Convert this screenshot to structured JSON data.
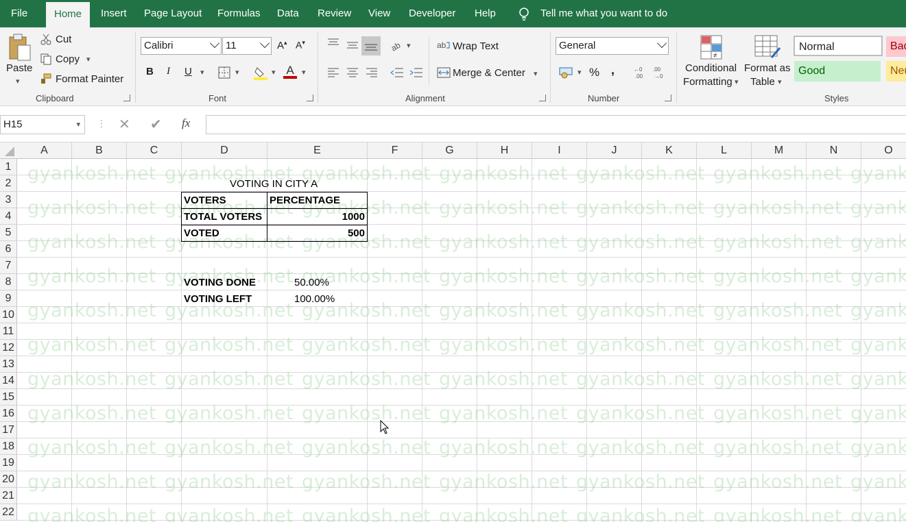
{
  "menu": {
    "file": "File",
    "home": "Home",
    "insert": "Insert",
    "page_layout": "Page Layout",
    "formulas": "Formulas",
    "data": "Data",
    "review": "Review",
    "view": "View",
    "developer": "Developer",
    "help": "Help",
    "tell_me": "Tell me what you want to do"
  },
  "clipboard": {
    "paste": "Paste",
    "cut": "Cut",
    "copy": "Copy",
    "format_painter": "Format Painter",
    "label": "Clipboard"
  },
  "font": {
    "name": "Calibri",
    "size": "11",
    "label": "Font",
    "bold": "B",
    "italic": "I",
    "underline": "U"
  },
  "alignment": {
    "wrap_text": "Wrap Text",
    "merge_center": "Merge & Center",
    "label": "Alignment"
  },
  "number": {
    "format": "General",
    "label": "Number",
    "percent": "%",
    "comma": ","
  },
  "styles": {
    "conditional_line1": "Conditional",
    "conditional_line2": "Formatting",
    "format_as_line1": "Format as",
    "format_as_line2": "Table",
    "normal": "Normal",
    "bad": "Bad",
    "good": "Good",
    "neutral": "Neu",
    "label": "Styles"
  },
  "formula_bar": {
    "name_box": "H15",
    "fx": "fx",
    "content": ""
  },
  "columns": [
    "A",
    "B",
    "C",
    "D",
    "E",
    "F",
    "G",
    "H",
    "I",
    "J",
    "K",
    "L",
    "M",
    "N",
    "O"
  ],
  "rows": [
    "1",
    "2",
    "3",
    "4",
    "5",
    "6",
    "7",
    "8",
    "9",
    "10",
    "11",
    "12",
    "13",
    "14",
    "15",
    "16",
    "17",
    "18",
    "19",
    "20",
    "21",
    "22"
  ],
  "watermark": "gyankosh.net",
  "sheet": {
    "title": "VOTING IN CITY A",
    "header_voters": "VOTERS",
    "header_percentage": "PERCENTAGE",
    "total_voters_label": "TOTAL VOTERS",
    "total_voters_value": "1000",
    "voted_label": "VOTED",
    "voted_value": "500",
    "voting_done_label": "VOTING DONE",
    "voting_done_value": "50.00%",
    "voting_left_label": "VOTING LEFT",
    "voting_left_value": "100.00%"
  },
  "colors": {
    "brand": "#217346",
    "ribbon": "#f3f3f3",
    "good_fill": "#c6efce",
    "bad_fill": "#ffc7ce",
    "neutral_fill": "#ffeb9c"
  }
}
